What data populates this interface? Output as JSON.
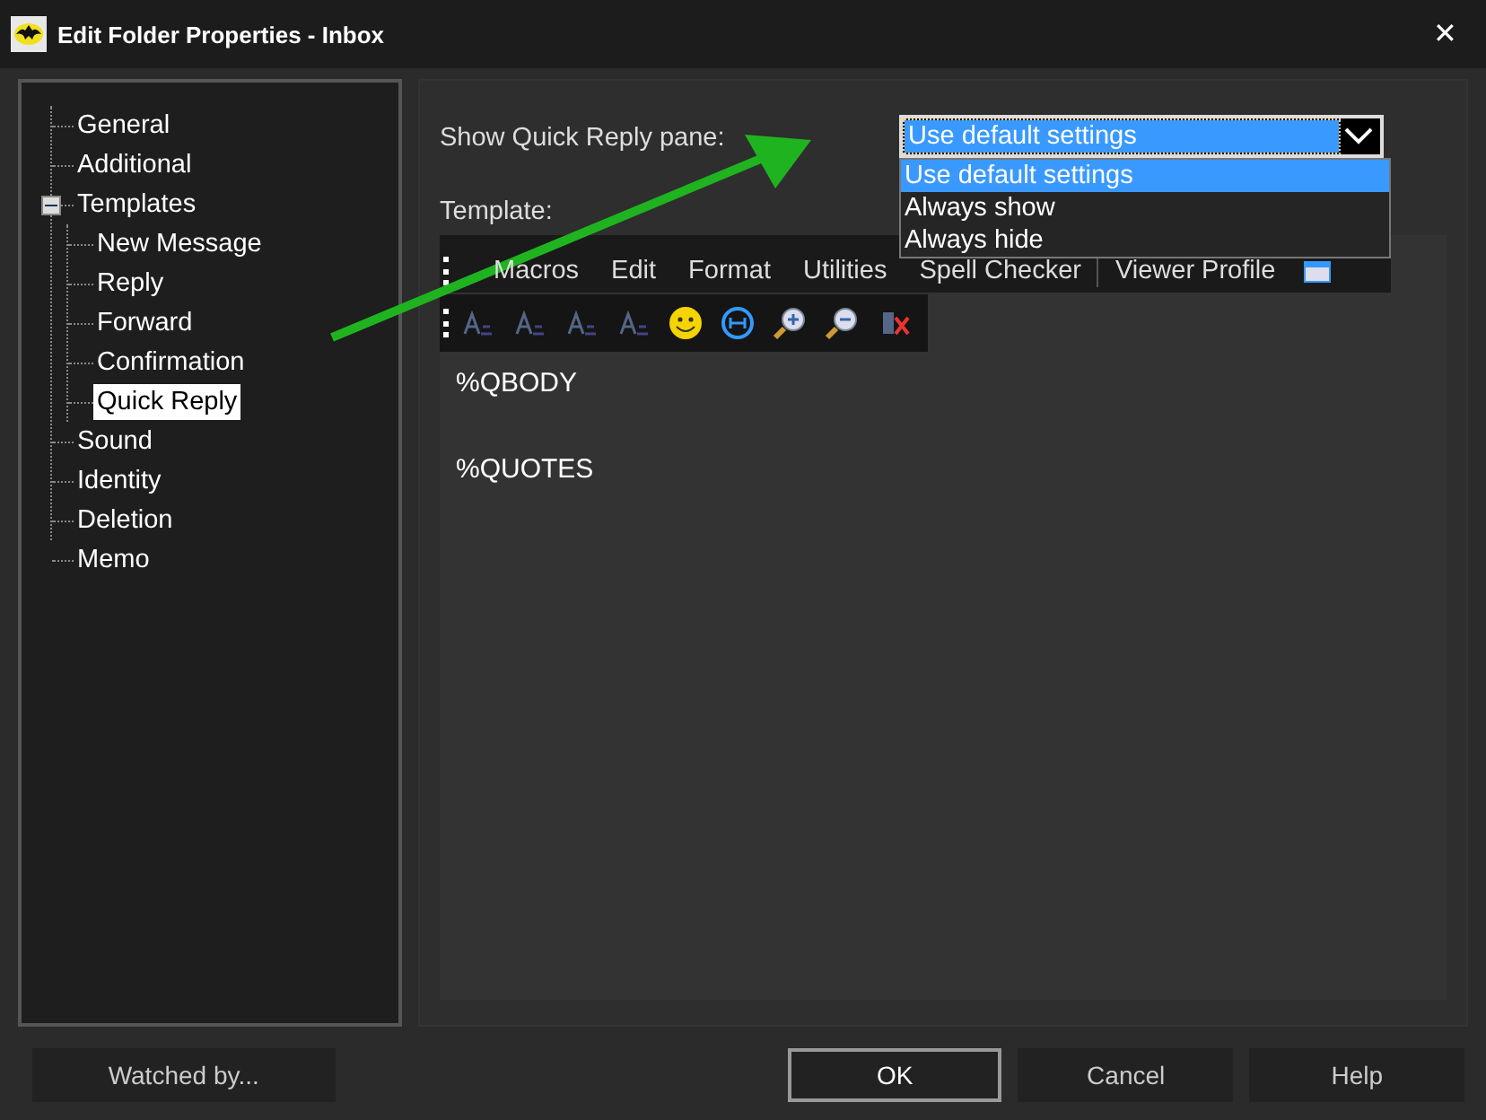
{
  "window": {
    "title": "Edit Folder Properties - Inbox",
    "close": "✕"
  },
  "tree": [
    {
      "label": "General",
      "selected": false
    },
    {
      "label": "Additional",
      "selected": false
    },
    {
      "label": "Templates",
      "selected": false,
      "expanded": true,
      "children": [
        {
          "label": "New Message",
          "selected": false
        },
        {
          "label": "Reply",
          "selected": false
        },
        {
          "label": "Forward",
          "selected": false
        },
        {
          "label": "Confirmation",
          "selected": false
        },
        {
          "label": "Quick Reply",
          "selected": true
        }
      ]
    },
    {
      "label": "Sound",
      "selected": false
    },
    {
      "label": "Identity",
      "selected": false
    },
    {
      "label": "Deletion",
      "selected": false
    },
    {
      "label": "Memo",
      "selected": false
    }
  ],
  "quick_reply": {
    "label": "Show Quick Reply pane:",
    "value": "Use default settings",
    "options": [
      {
        "label": "Use default settings",
        "selected": true
      },
      {
        "label": "Always show",
        "selected": false
      },
      {
        "label": "Always hide",
        "selected": false
      }
    ]
  },
  "template": {
    "label": "Template:",
    "menu": [
      "Macros",
      "Edit",
      "Format",
      "Utilities",
      "Spell Checker",
      "Viewer Profile"
    ],
    "lines": [
      "%QBODY",
      "%QUOTES"
    ]
  },
  "buttons": [
    {
      "label": "Watched by...",
      "default": false
    },
    {
      "label": "OK",
      "default": true
    },
    {
      "label": "Cancel",
      "default": false
    },
    {
      "label": "Help",
      "default": false
    }
  ]
}
